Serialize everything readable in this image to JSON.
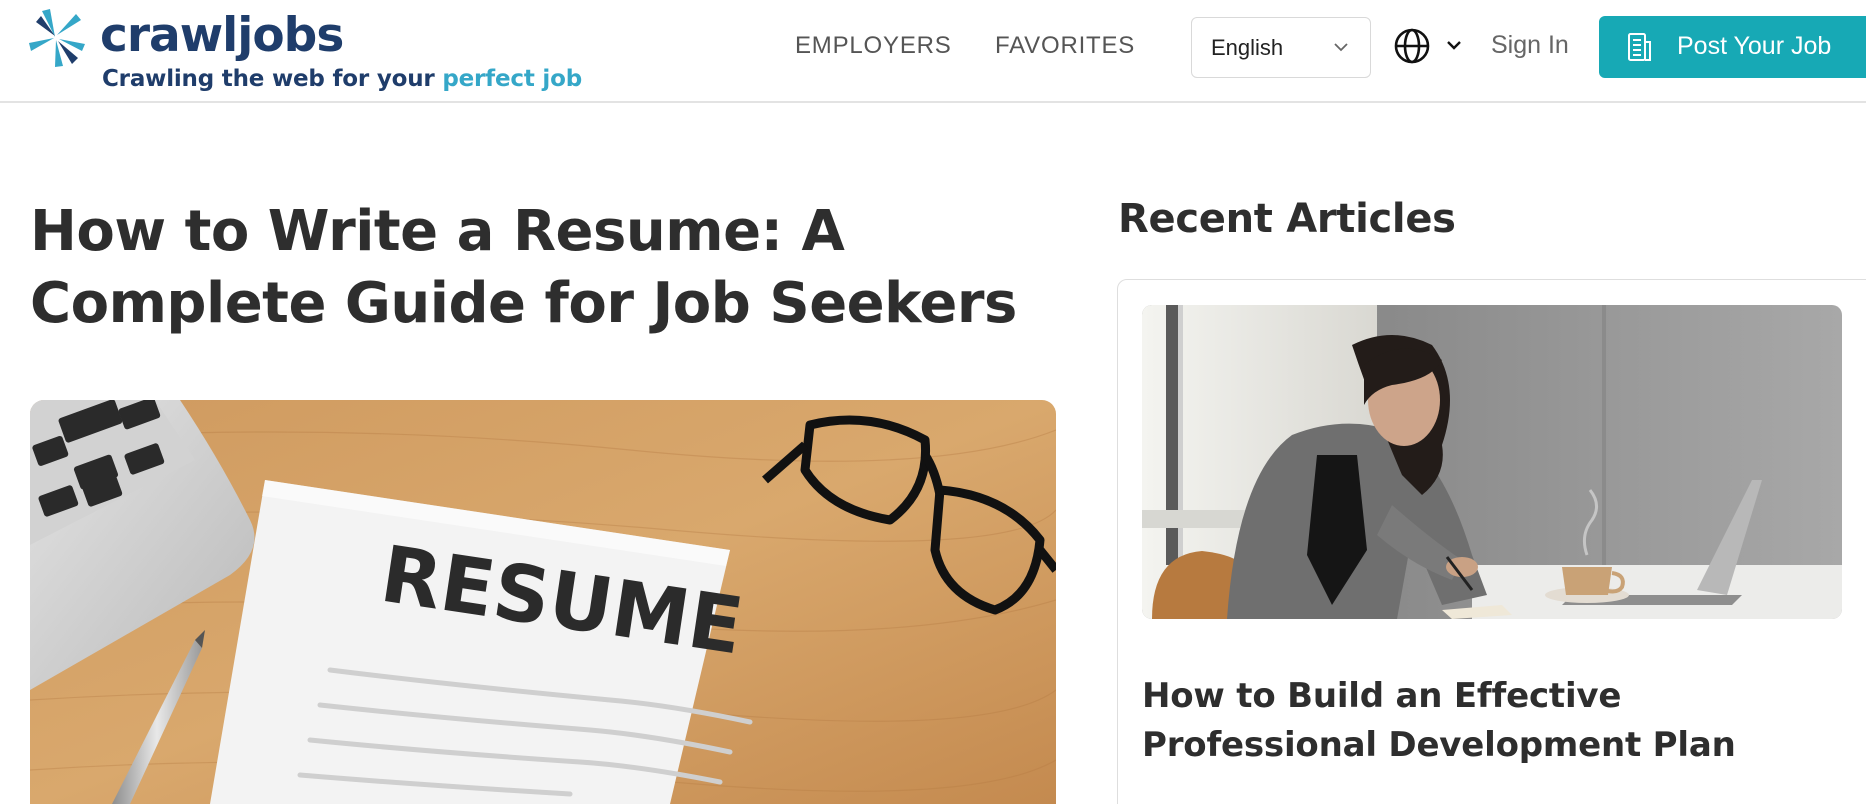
{
  "header": {
    "logo": {
      "wordmark": "crawljobs",
      "tagline_main": "Crawling the web for your ",
      "tagline_accent": "perfect job"
    },
    "nav": {
      "employers": "EMPLOYERS",
      "favorites": "FAVORITES"
    },
    "language": {
      "selected": "English",
      "globe_icon": "globe-icon"
    },
    "sign_in": "Sign In",
    "post_job": {
      "label": "Post Your Job",
      "icon": "building-icon"
    }
  },
  "article": {
    "title": "How to Write a Resume: A Complete Guide for Job Seekers",
    "hero_text": "RESUME"
  },
  "sidebar": {
    "heading": "Recent Articles",
    "cards": [
      {
        "title": "How to Build an Effective Professional Development Plan"
      }
    ]
  },
  "colors": {
    "brand_navy": "#1f3d6b",
    "brand_light_blue": "#35a7c8",
    "post_button": "#17a9b5",
    "heading_text": "#2e2e2e"
  }
}
